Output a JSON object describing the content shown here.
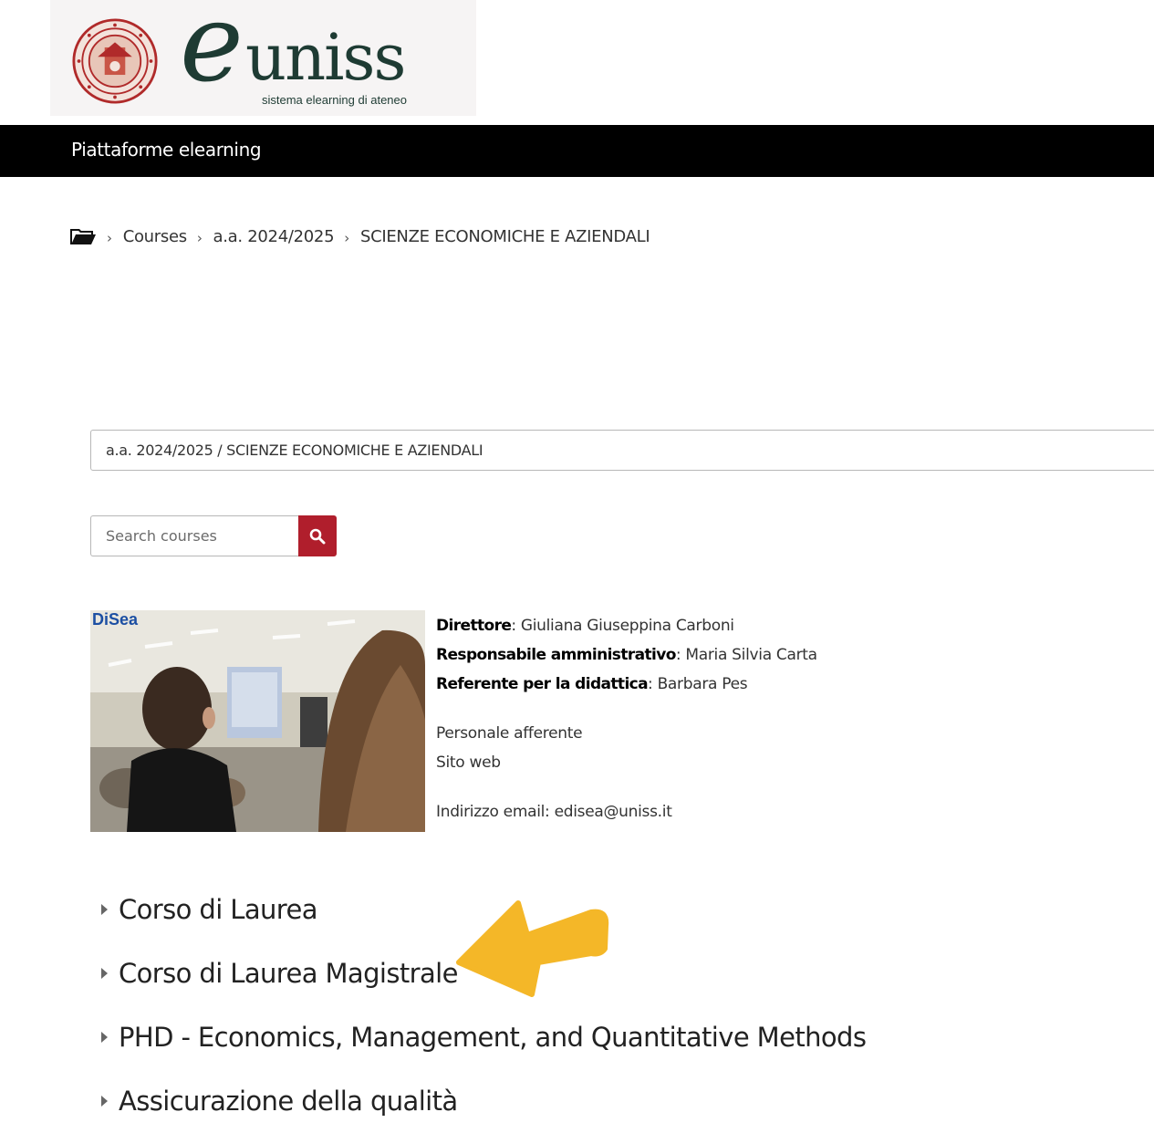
{
  "header": {
    "logo_text": "uniss",
    "logo_tagline": "sistema elearning di ateneo",
    "nav_title": "Piattaforme elearning"
  },
  "breadcrumb": {
    "items": [
      "Courses",
      "a.a. 2024/2025",
      "SCIENZE ECONOMICHE E AZIENDALI"
    ]
  },
  "category_select": {
    "value": "a.a. 2024/2025 / SCIENZE ECONOMICHE E AZIENDALI"
  },
  "search": {
    "placeholder": "Search courses"
  },
  "department": {
    "image_logo": "DiSea",
    "director_label": "Direttore",
    "director_value": ": Giuliana Giuseppina Carboni",
    "admin_label": "Responsabile amministrativo",
    "admin_value": ": Maria Silvia Carta",
    "teaching_label": "Referente per la didattica",
    "teaching_value": ": Barbara Pes",
    "staff_link": "Personale afferente",
    "website_link": "Sito web",
    "email": "Indirizzo email: edisea@uniss.it"
  },
  "categories": [
    {
      "label": "Corso di Laurea"
    },
    {
      "label": "Corso di Laurea Magistrale"
    },
    {
      "label": "PHD - Economics, Management, and Quantitative Methods"
    },
    {
      "label": "Assicurazione della qualità"
    }
  ],
  "colors": {
    "navbar": "#000000",
    "search_button": "#b01e2c",
    "arrow": "#f4b728",
    "logo_green": "#1e3b33"
  }
}
